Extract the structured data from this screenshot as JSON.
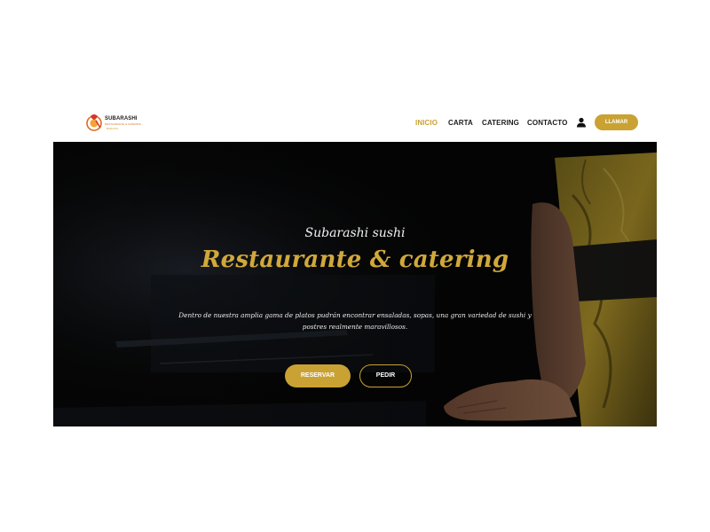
{
  "header": {
    "logo": {
      "name": "SUBARASHI",
      "subtitle_line1": "RESTAURANTE & CATERING",
      "subtitle_line2": "BURGOS"
    },
    "nav": [
      {
        "label": "INICIO",
        "active": true
      },
      {
        "label": "CARTA",
        "active": false
      },
      {
        "label": "CATERING",
        "active": false
      },
      {
        "label": "CONTACTO",
        "active": false
      }
    ],
    "user_icon": "user-icon",
    "call_button": "LLAMAR"
  },
  "hero": {
    "tagline": "Subarashi sushi",
    "headline": "Restaurante & catering",
    "description_line1": "Dentro de nuestra amplia gama de platos pudrán encontrar ensaladas, sopas, una gran variedad de sushi y",
    "description_line2": "postres realmente maravillosos.",
    "buttons": {
      "reservar": "RESERVAR",
      "pedir": "PEDIR"
    }
  },
  "colors": {
    "accent": "#c9a233",
    "headline": "#d1a83a",
    "hero_bg": "#050505",
    "text_dark": "#1c1c1c"
  }
}
